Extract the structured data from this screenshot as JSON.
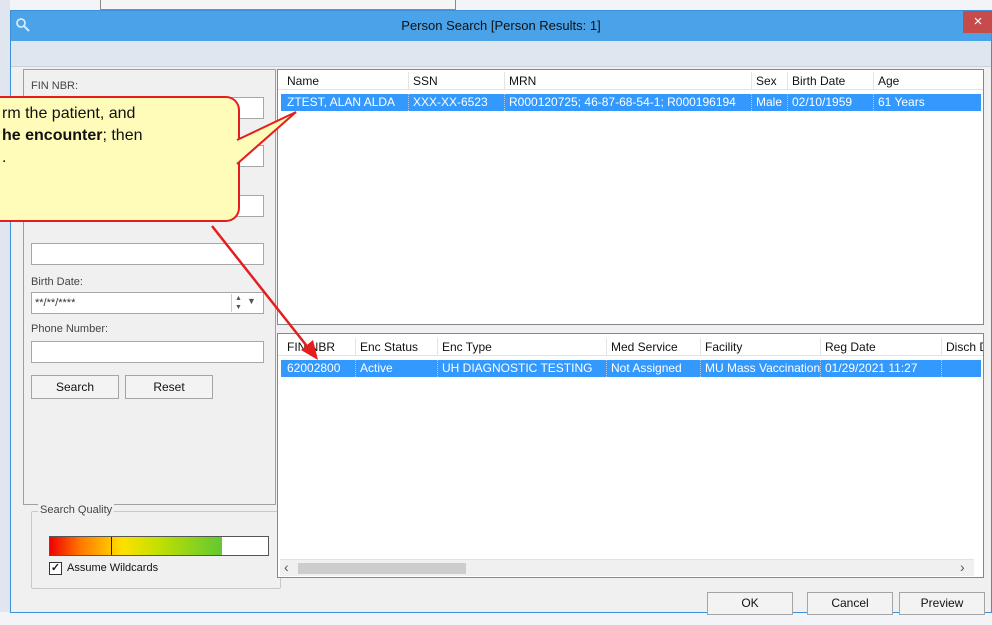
{
  "dialog": {
    "title": "Person Search  [Person Results: 1]",
    "close_glyph": "×"
  },
  "search_panel": {
    "fields": [
      {
        "label": "FIN NBR:",
        "value": ""
      },
      {
        "label": "",
        "value": ""
      },
      {
        "label": "",
        "value": ""
      },
      {
        "label": "",
        "value": ""
      },
      {
        "label": "",
        "value": ""
      }
    ],
    "birth_date": {
      "label": "Birth Date:",
      "value": "**/**/****"
    },
    "phone": {
      "label": "Phone Number:",
      "value": ""
    },
    "search_label": "Search",
    "reset_label": "Reset"
  },
  "search_quality": {
    "legend": "Search Quality",
    "fill_fraction": 0.79,
    "marker_fraction": 0.28,
    "assume_wildcards_label": "Assume Wildcards",
    "assume_wildcards_checked": true,
    "check_glyph": "✓"
  },
  "persons_table": {
    "columns": [
      "Name",
      "SSN",
      "MRN",
      "Sex",
      "Birth Date",
      "Age"
    ],
    "rows": [
      [
        "ZTEST, ALAN ALDA",
        "XXX-XX-6523",
        "R000120725; 46-87-68-54-1; R000196194",
        "Male",
        "02/10/1959",
        "61 Years"
      ]
    ]
  },
  "encounters_table": {
    "columns": [
      "FIN NBR",
      "Enc Status",
      "Enc Type",
      "Med Service",
      "Facility",
      "Reg Date",
      "Disch D"
    ],
    "rows": [
      [
        "62002800",
        "Active",
        "UH DIAGNOSTIC TESTING",
        "Not Assigned",
        "MU Mass Vaccination",
        "01/29/2021 11:27",
        ""
      ]
    ]
  },
  "scroll": {
    "left_arrow": "‹",
    "right_arrow": "›"
  },
  "footer": {
    "ok_label": "OK",
    "cancel_label": "Cancel",
    "preview_label": "Preview"
  },
  "callout": {
    "line1": "rm the patient, and",
    "line2_bold": "he encounter",
    "line2_rest": "; then",
    "line3": "."
  },
  "colors": {
    "titlebar": "#4aa2e8",
    "selection": "#3399ff",
    "callout_fill": "#fffbb8",
    "callout_border": "#e41e1e"
  }
}
